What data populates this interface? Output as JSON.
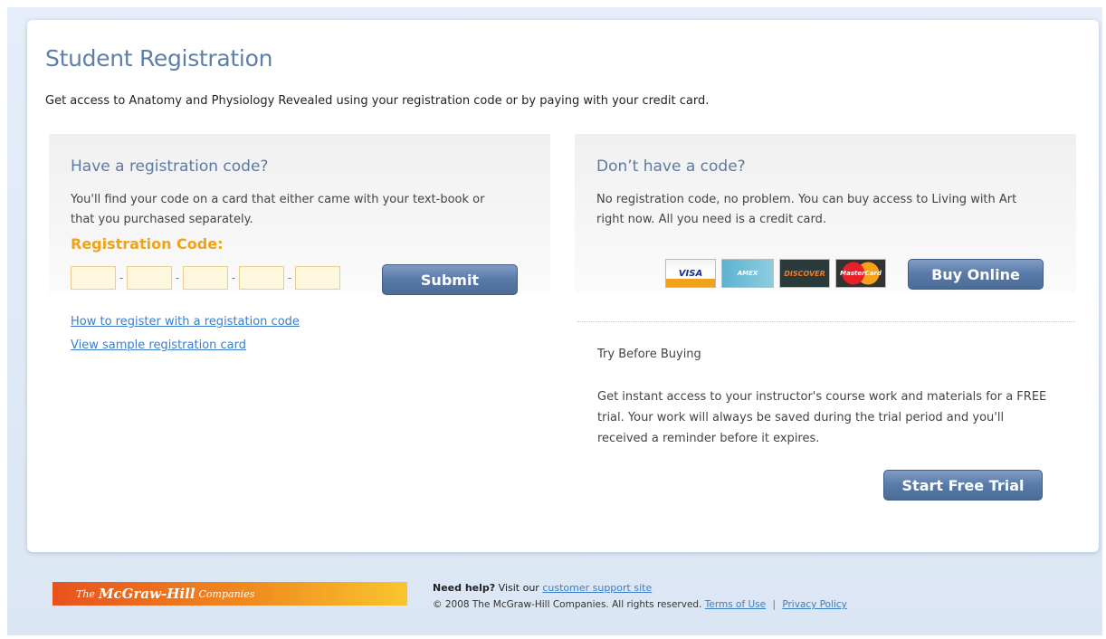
{
  "page": {
    "title": "Student Registration",
    "intro": "Get access to Anatomy and Physiology Revealed using your registration code or by paying with your credit card."
  },
  "left_panel": {
    "title": "Have a registration code?",
    "text": "You'll find your code on a card that either came with your text-book or that you purchased separately.",
    "code_label": "Registration Code:",
    "code_fields": [
      "",
      "",
      "",
      "",
      ""
    ],
    "submit_label": "Submit",
    "links": [
      "How to register with a registation code",
      "View sample registration card"
    ]
  },
  "right_panel": {
    "title": "Don’t have a code?",
    "text": "No registration code, no problem. You can buy access to Living with Art right now. All you need is a credit card.",
    "cards": [
      "VISA",
      "AMEX",
      "DISCOVER",
      "MasterCard"
    ],
    "card_icons": [
      "visa-icon",
      "amex-icon",
      "discover-icon",
      "mastercard-icon"
    ],
    "buy_label": "Buy Online"
  },
  "trial": {
    "title": "Try Before Buying",
    "text": "Get instant access to your instructor's course work and materials for a FREE trial. Your work will always be saved during the trial period and you'll received a reminder before it expires.",
    "button_label": "Start Free Trial"
  },
  "footer": {
    "logo_the": "The",
    "logo_brand": "McGraw-Hill",
    "logo_companies": "Companies",
    "help_prefix": "Need help?",
    "help_mid": "Visit our",
    "help_link": "customer support site",
    "copyright": "© 2008 The McGraw-Hill Companies. All rights reserved.",
    "terms": "Terms of Use",
    "separator": "|",
    "privacy": "Privacy Policy"
  },
  "colors": {
    "accent": "#5f7ea8",
    "button": "#587aa8",
    "label_orange": "#f0a21b",
    "link": "#3b7ec7"
  }
}
